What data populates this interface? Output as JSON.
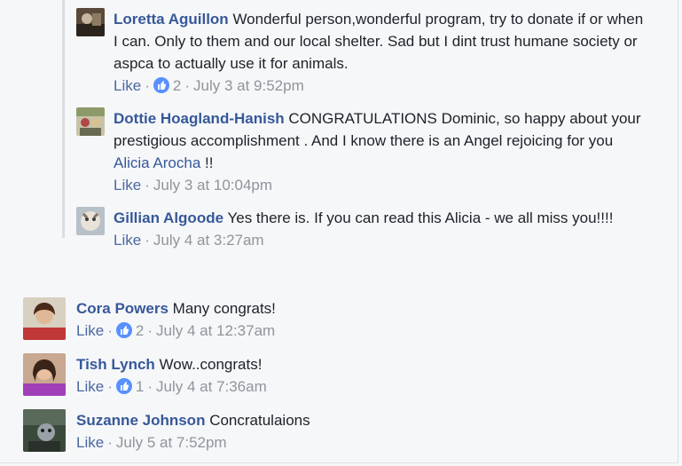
{
  "colors": {
    "link": "#365899",
    "like": "#4b67a1",
    "meta": "#90949c",
    "like_badge": "#5890ff",
    "background": "#f6f7f9"
  },
  "replies": [
    {
      "author": "Loretta Aguillon",
      "text": "Wonderful person,wonderful program, try to donate if or when I can. Only to them and our local shelter. Sad but I dint trust humane society or aspca to actually use it for animals.",
      "like_label": "Like",
      "reaction_icon": "thumbs-up-icon",
      "reaction_count": "2",
      "timestamp": "July 3 at 9:52pm"
    },
    {
      "author": "Dottie Hoagland-Hanish",
      "text_before": "CONGRATULATIONS Dominic, so happy about your prestigious accomplishment . And I know there is an Angel rejoicing for you",
      "mention": "Alicia Arocha",
      "text_after": "!!",
      "like_label": "Like",
      "timestamp": "July 3 at 10:04pm"
    },
    {
      "author": "Gillian Algoode",
      "text": "Yes there is. If you can read this Alicia - we all miss you!!!!",
      "like_label": "Like",
      "timestamp": "July 4 at 3:27am"
    }
  ],
  "comments": [
    {
      "author": "Cora Powers",
      "text": "Many congrats!",
      "like_label": "Like",
      "reaction_icon": "thumbs-up-icon",
      "reaction_count": "2",
      "timestamp": "July 4 at 12:37am"
    },
    {
      "author": "Tish Lynch",
      "text": "Wow..congrats!",
      "like_label": "Like",
      "reaction_icon": "thumbs-up-icon",
      "reaction_count": "1",
      "timestamp": "July 4 at 7:36am"
    },
    {
      "author": "Suzanne Johnson",
      "text": "Concratulaions",
      "like_label": "Like",
      "timestamp": "July 5 at 7:52pm"
    }
  ]
}
